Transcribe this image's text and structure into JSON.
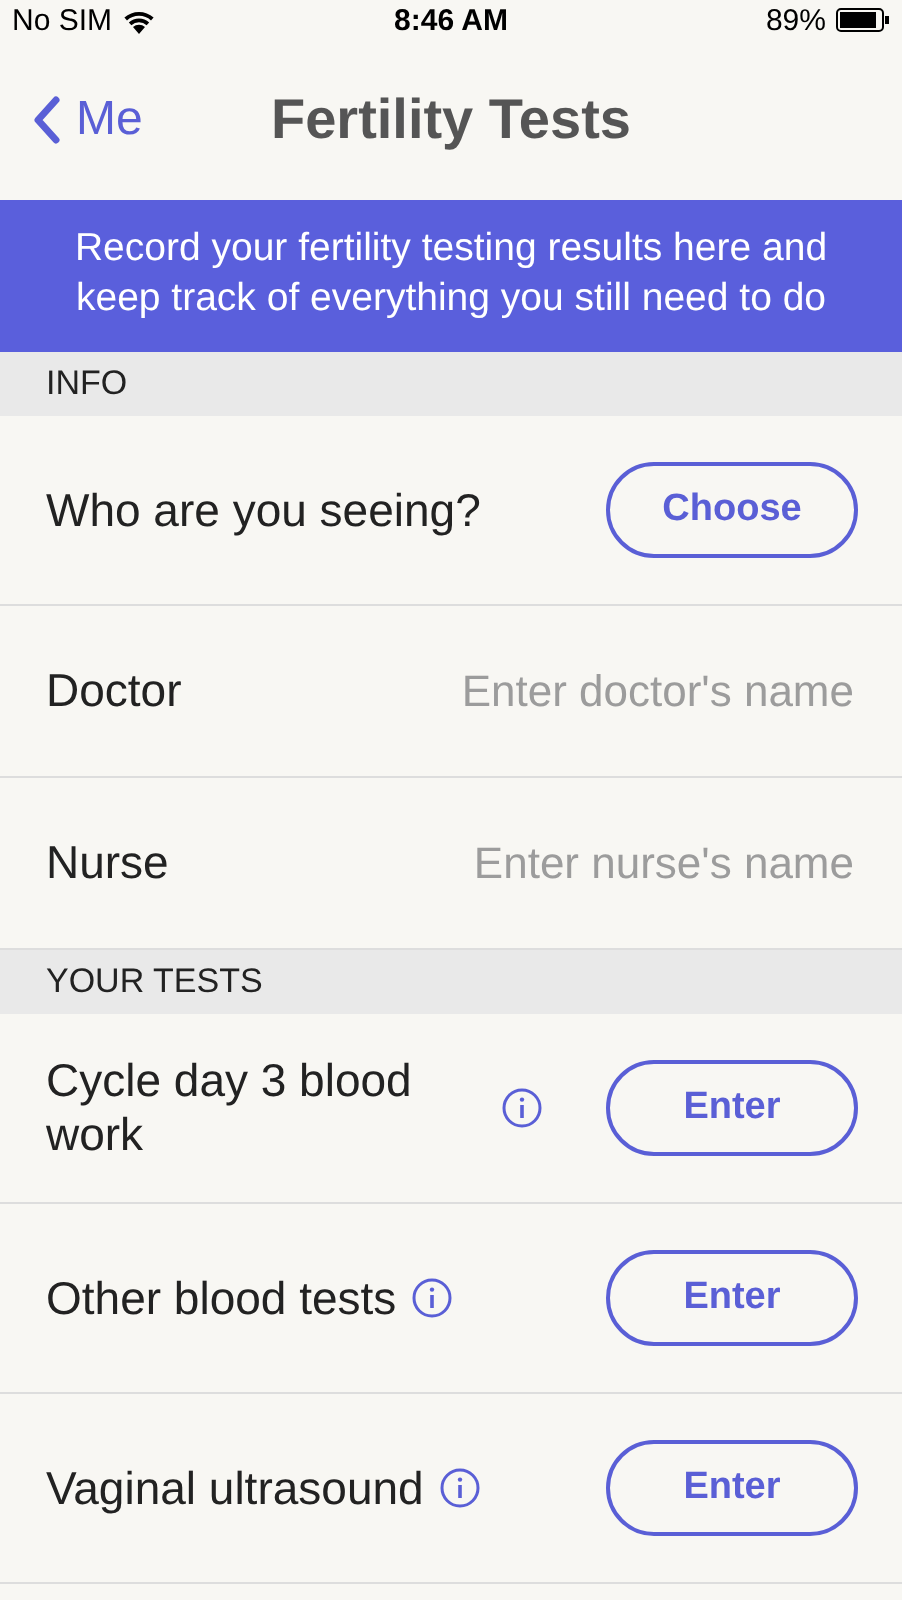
{
  "status_bar": {
    "carrier": "No SIM",
    "time": "8:46 AM",
    "battery": "89%"
  },
  "nav": {
    "back": "Me",
    "title": "Fertility Tests"
  },
  "banner": "Record your fertility testing results here and keep track of everything you still need to do",
  "sections": [
    {
      "header": "INFO",
      "rows": [
        {
          "kind": "button",
          "label": "Who are you seeing?",
          "info": false,
          "button": "Choose"
        },
        {
          "kind": "field",
          "label": "Doctor",
          "placeholder": "Enter doctor's name"
        },
        {
          "kind": "field",
          "label": "Nurse",
          "placeholder": "Enter nurse's name"
        }
      ]
    },
    {
      "header": "YOUR TESTS",
      "rows": [
        {
          "kind": "button",
          "label": "Cycle day 3 blood work",
          "info": true,
          "button": "Enter"
        },
        {
          "kind": "button",
          "label": "Other blood tests",
          "info": true,
          "button": "Enter"
        },
        {
          "kind": "button",
          "label": "Vaginal ultrasound",
          "info": true,
          "button": "Enter"
        }
      ]
    }
  ]
}
